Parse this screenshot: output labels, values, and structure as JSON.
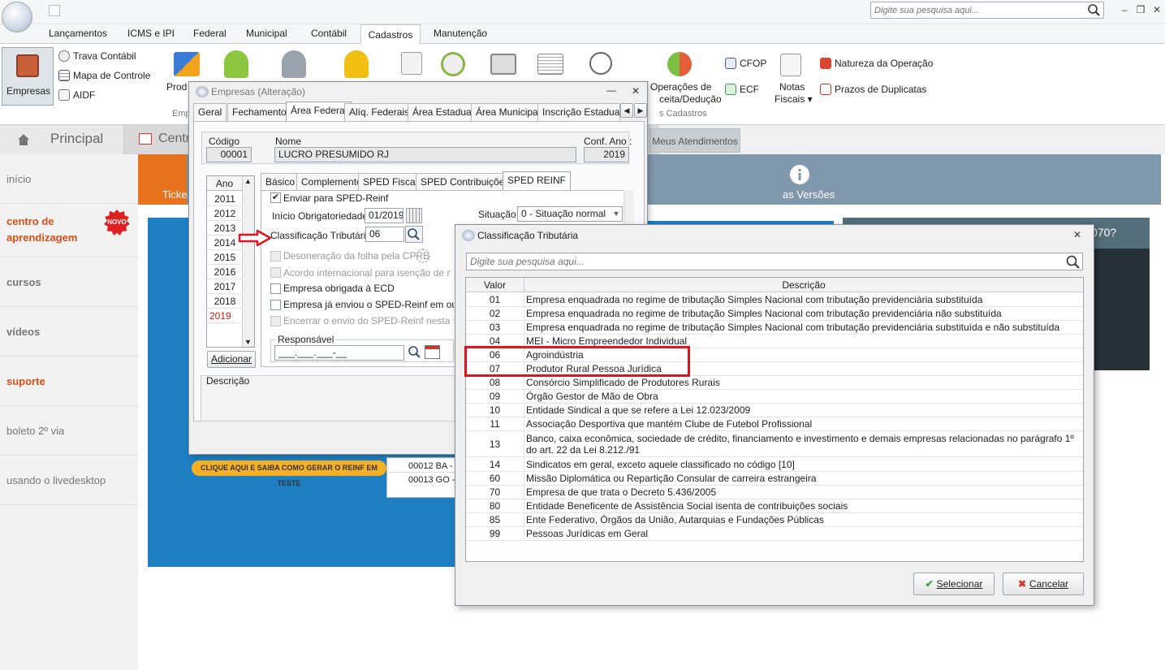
{
  "titlebar": {
    "search_placeholder": "Digite sua pesquisa aqui...",
    "minimize": "–",
    "restore": "❐",
    "close": "✕"
  },
  "ribbon_tabs": [
    "Lançamentos",
    "ICMS e IPI",
    "Federal",
    "Municipal",
    "Contábil",
    "Cadastros",
    "Manutenção"
  ],
  "ribbon": {
    "empresas": "Empresas",
    "trava": "Trava Contábil",
    "mapa": "Mapa de Controle",
    "aidf": "AIDF",
    "prod": "Prod",
    "emp_group": "Emp",
    "operacoes_1": "Operações de",
    "operacoes_2": "ceita/Dedução",
    "cadastros_group": "s Cadastros",
    "cfop": "CFOP",
    "ecf": "ECF",
    "notas_1": "Notas",
    "notas_2": "Fiscais ▾",
    "natureza": "Natureza da Operação",
    "prazos": "Prazos de Duplicatas"
  },
  "main_tabs": {
    "principal": "Principal",
    "central": "Centra",
    "meus": "Meus Atendimentos"
  },
  "sidebar": [
    {
      "label": "início",
      "red": false
    },
    {
      "label": "centro de aprendizagem",
      "red": true
    },
    {
      "label": "cursos",
      "red": false
    },
    {
      "label": "vídeos",
      "red": false
    },
    {
      "label": "suporte",
      "red": true
    },
    {
      "label": "boleto 2º via",
      "red": false
    },
    {
      "label": "usando o livedesktop",
      "red": false
    }
  ],
  "novo_badge": "NOVO",
  "content": {
    "ticket": "Ticke",
    "novas_versoes": "as Versões",
    "question": "070?",
    "cta": "CLIQUE AQUI E SAIBA COMO GERAR O REINF EM TESTE",
    "grid_row1": "00012  BA -",
    "grid_row2": "00013  GO -"
  },
  "empresas_window": {
    "title": "Empresas (Alteração)",
    "tabs": [
      "Geral",
      "Fechamento",
      "Área Federal",
      "Alíq. Federais",
      "Área Estadual",
      "Área Municipal",
      "Inscrição Estadual S"
    ],
    "codigo_label": "Código",
    "codigo": "00001",
    "nome_label": "Nome",
    "nome": "LUCRO PRESUMIDO RJ",
    "conf_ano_label": "Conf. Ano :",
    "conf_ano": "2019",
    "ano_header": "Ano",
    "years": [
      "2011",
      "2012",
      "2013",
      "2014",
      "2015",
      "2016",
      "2017",
      "2018",
      "2019"
    ],
    "adicionar": "Adicionar",
    "descricao_label": "Descrição",
    "subtabs": [
      "Básico",
      "Complemento",
      "SPED Fiscal",
      "SPED Contribuições",
      "SPED REINF"
    ],
    "enviar_sped": "Enviar para SPED-Reinf",
    "inicio_label": "Início Obrigatoriedade:",
    "inicio": "01/2019",
    "situacao_label": "Situação:",
    "situacao": "0 - Situação normal",
    "classificacao_label": "Classificação Tributária:",
    "classificacao": "06",
    "desoneracao": "Desoneração da folha pela CPRB",
    "acordo": "Acordo internacional para isenção de multa",
    "obrigada_ecd": "Empresa obrigada à ECD",
    "ja_enviou": "Empresa já enviou o SPED-Reinf em outra S",
    "encerrar": "Encerrar o envio do SPED-Reinf nesta Softw",
    "responsavel_label": "Responsável",
    "responsavel": "___.___.___-__"
  },
  "classificacao_dialog": {
    "title": "Classificação Tributária",
    "search_placeholder": "Digite sua pesquisa aqui...",
    "col_valor": "Valor",
    "col_descricao": "Descrição",
    "rows": [
      {
        "valor": "01",
        "descricao": "Empresa enquadrada no regime de tributação Simples Nacional com tributação previdenciária substituída"
      },
      {
        "valor": "02",
        "descricao": "Empresa enquadrada no regime de tributação Simples Nacional com tributação previdenciária não substituída"
      },
      {
        "valor": "03",
        "descricao": "Empresa enquadrada no regime de tributação Simples Nacional com tributação previdenciária substituída e não substituída"
      },
      {
        "valor": "04",
        "descricao": "MEI - Micro Empreendedor Individual"
      },
      {
        "valor": "06",
        "descricao": "Agroindústria"
      },
      {
        "valor": "07",
        "descricao": "Produtor Rural Pessoa Jurídica"
      },
      {
        "valor": "08",
        "descricao": "Consórcio Simplificado de Produtores Rurais"
      },
      {
        "valor": "09",
        "descricao": "Órgão Gestor de Mão de Obra"
      },
      {
        "valor": "10",
        "descricao": "Entidade Sindical a que se refere a Lei 12.023/2009"
      },
      {
        "valor": "11",
        "descricao": "Associação Desportiva que mantém Clube de Futebol Profissional"
      },
      {
        "valor": "13",
        "descricao": "Banco, caixa econômica, sociedade de crédito, financiamento e investimento e demais empresas relacionadas no parágrafo 1º do art. 22 da Lei 8.212./91"
      },
      {
        "valor": "14",
        "descricao": "Sindicatos em geral, exceto aquele classificado no código [10]"
      },
      {
        "valor": "60",
        "descricao": "Missão Diplomática ou Repartição Consular de carreira estrangeira"
      },
      {
        "valor": "70",
        "descricao": "Empresa de que trata o Decreto 5.436/2005"
      },
      {
        "valor": "80",
        "descricao": "Entidade Beneficente de Assistência Social isenta de contribuições sociais"
      },
      {
        "valor": "85",
        "descricao": "Ente Federativo, Órgãos da União, Autarquias e Fundações Públicas"
      },
      {
        "valor": "99",
        "descricao": "Pessoas Jurídicas em Geral"
      }
    ],
    "selecionar": "Selecionar",
    "cancelar": "Cancelar"
  }
}
